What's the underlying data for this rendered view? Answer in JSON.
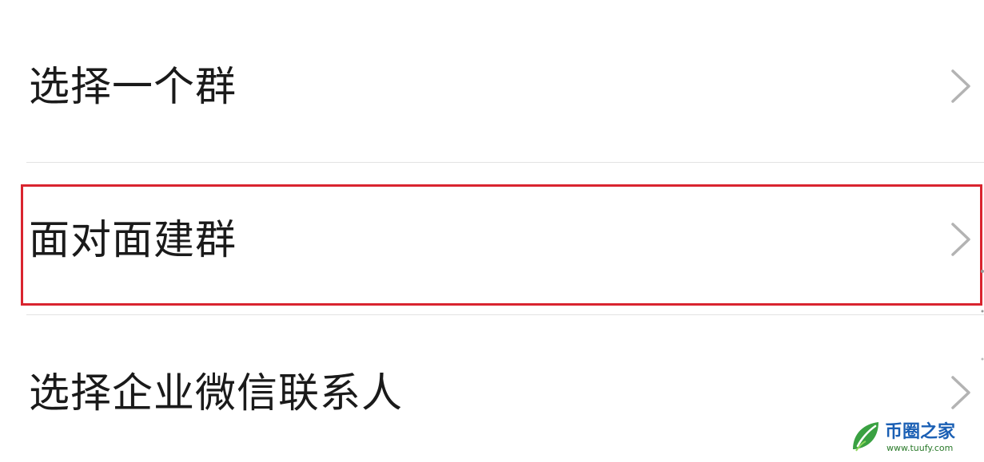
{
  "menu": {
    "items": [
      {
        "label": "选择一个群"
      },
      {
        "label": "面对面建群"
      },
      {
        "label": "选择企业微信联系人"
      }
    ]
  },
  "highlight": {
    "color": "#d9242f"
  },
  "watermark": {
    "brand": "币圈之家",
    "domain": "www.tuufy.com"
  },
  "colors": {
    "text": "#1a1a1a",
    "chevron": "#b3b3b3",
    "divider": "#e3e3e3"
  }
}
